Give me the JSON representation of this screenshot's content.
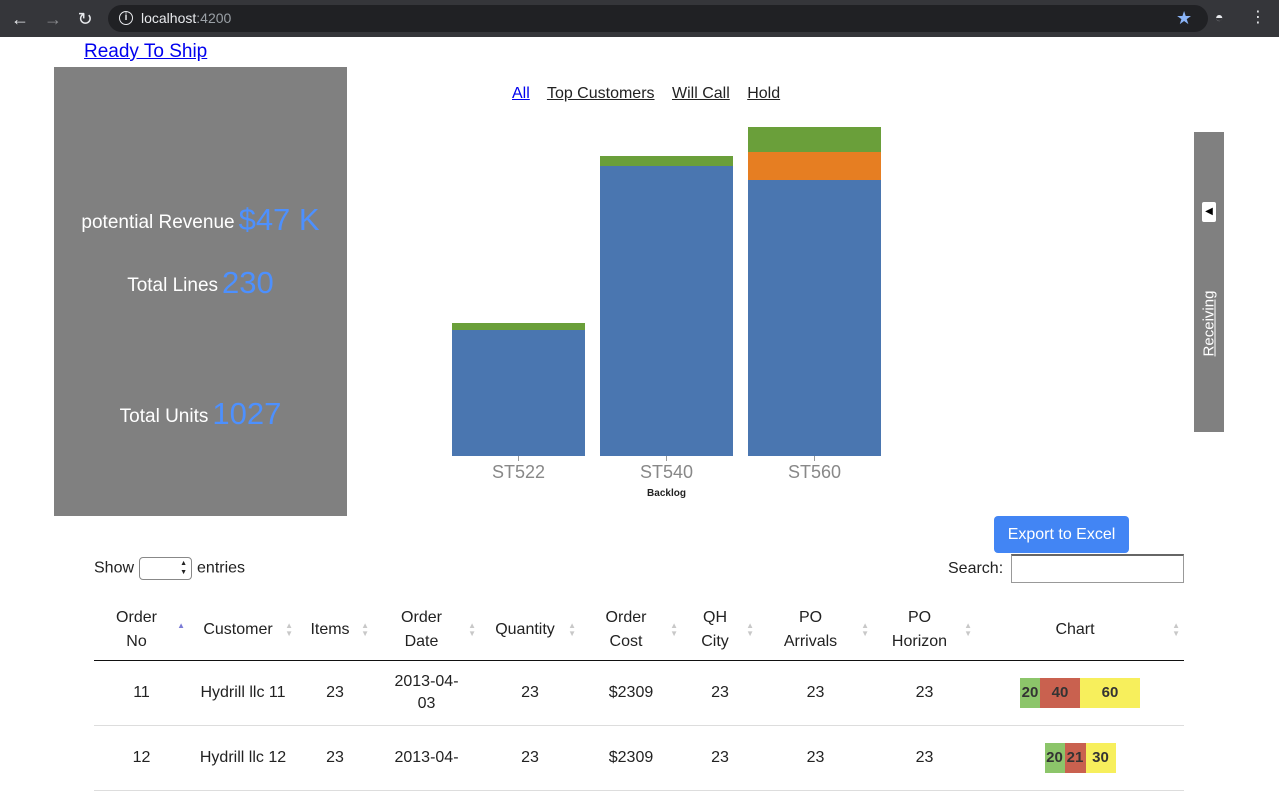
{
  "browser": {
    "url_host": "localhost",
    "url_port": ":4200"
  },
  "page": {
    "ready_link": "Ready To Ship"
  },
  "stats": {
    "revenue_label": "potential Revenue",
    "revenue_value": "$47 K",
    "lines_label": "Total Lines",
    "lines_value": "230",
    "units_label": "Total Units",
    "units_value": "1027"
  },
  "filters": [
    "All",
    "Top Customers",
    "Will Call",
    "Hold"
  ],
  "side_tab": {
    "label": "Receiving"
  },
  "export_label": "Export to Excel",
  "show_entries": {
    "before": "Show",
    "after": "entries"
  },
  "search_label": "Search:",
  "table": {
    "columns": [
      [
        "Order",
        "No"
      ],
      [
        "Customer"
      ],
      [
        "Items"
      ],
      [
        "Order",
        "Date"
      ],
      [
        "Quantity"
      ],
      [
        "Order",
        "Cost"
      ],
      [
        "QH",
        "City"
      ],
      [
        "PO",
        "Arrivals"
      ],
      [
        "PO",
        "Horizon"
      ],
      [
        "Chart"
      ]
    ],
    "rows": [
      {
        "order_no": "11",
        "customer": "Hydrill llc 11",
        "items": "23",
        "date": "2013-04-03",
        "quantity": "23",
        "cost": "$2309",
        "qh_city": "23",
        "po_arrivals": "23",
        "po_horizon": "23",
        "chart": [
          20,
          40,
          60
        ]
      },
      {
        "order_no": "12",
        "customer": "Hydrill llc 12",
        "items": "23",
        "date": "2013-04-",
        "quantity": "23",
        "cost": "$2309",
        "qh_city": "23",
        "po_arrivals": "23",
        "po_horizon": "23",
        "chart": [
          20,
          21,
          30
        ]
      }
    ]
  },
  "mini_chart_colors": [
    "#8cc56a",
    "#c9614f",
    "#f7ef5c"
  ],
  "chart_data": {
    "type": "bar",
    "stacked": true,
    "categories": [
      "ST522",
      "ST540",
      "ST560"
    ],
    "series": [
      {
        "color": "#4a76b0",
        "values": [
          126,
          290,
          276
        ]
      },
      {
        "color": "#e67e22",
        "values": [
          0,
          0,
          28
        ]
      },
      {
        "color": "#6a9f3a",
        "values": [
          7,
          10,
          25
        ]
      }
    ],
    "xlabel": "Backlog",
    "ylim": [
      0,
      330
    ],
    "grid": false,
    "legend": "none"
  }
}
